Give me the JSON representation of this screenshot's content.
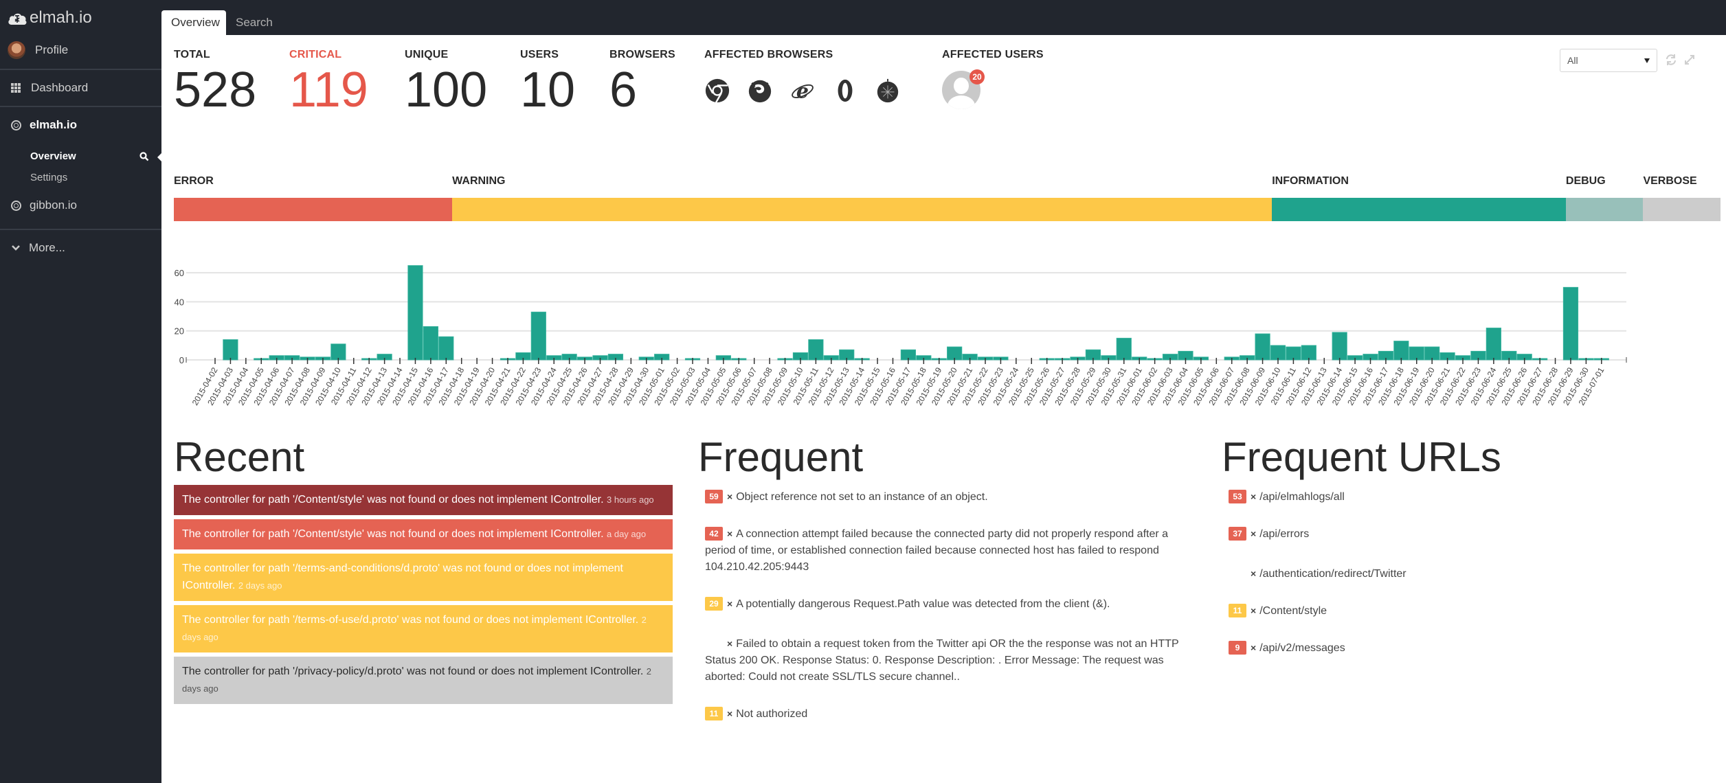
{
  "app": {
    "name": "elmah.io"
  },
  "sidebar": {
    "profile_label": "Profile",
    "dashboard_label": "Dashboard",
    "logs": [
      {
        "name": "elmah.io",
        "active": true,
        "sub": [
          {
            "label": "Overview",
            "active": true
          },
          {
            "label": "Settings",
            "active": false
          }
        ]
      },
      {
        "name": "gibbon.io",
        "active": false
      }
    ],
    "more_label": "More..."
  },
  "tabs": [
    {
      "label": "Overview",
      "active": true
    },
    {
      "label": "Search",
      "active": false
    }
  ],
  "stats": {
    "total": {
      "label": "TOTAL",
      "value": "528"
    },
    "critical": {
      "label": "CRITICAL",
      "value": "119"
    },
    "unique": {
      "label": "UNIQUE",
      "value": "100"
    },
    "users": {
      "label": "USERS",
      "value": "10"
    },
    "browsers": {
      "label": "BROWSERS",
      "value": "6"
    },
    "affected_browsers_label": "AFFECTED BROWSERS",
    "affected_browsers": [
      "chrome-icon",
      "firefox-icon",
      "internet-explorer-icon",
      "opera-icon",
      "safari-icon"
    ],
    "affected_users_label": "AFFECTED USERS",
    "affected_users_count": "20"
  },
  "filter": {
    "selected": "All"
  },
  "severity": {
    "segments": [
      {
        "label": "ERROR",
        "percent": 18,
        "color": "#e56353"
      },
      {
        "label": "WARNING",
        "percent": 53,
        "color": "#fdc848"
      },
      {
        "label": "INFORMATION",
        "percent": 19,
        "color": "#1fa38d"
      },
      {
        "label": "DEBUG",
        "percent": 5,
        "color": "#98c0ba"
      },
      {
        "label": "VERBOSE",
        "percent": 5,
        "color": "#cccccc"
      }
    ]
  },
  "chart_data": {
    "type": "bar",
    "title": "",
    "xlabel": "",
    "ylabel": "",
    "ylim": [
      0,
      65
    ],
    "yticks": [
      0,
      20,
      40,
      60
    ],
    "grid": true,
    "color": "#1fa38d",
    "categories": [
      "2015-04-02",
      "2015-04-03",
      "2015-04-04",
      "2015-04-05",
      "2015-04-06",
      "2015-04-07",
      "2015-04-08",
      "2015-04-09",
      "2015-04-10",
      "2015-04-11",
      "2015-04-12",
      "2015-04-13",
      "2015-04-14",
      "2015-04-15",
      "2015-04-16",
      "2015-04-17",
      "2015-04-18",
      "2015-04-19",
      "2015-04-20",
      "2015-04-21",
      "2015-04-22",
      "2015-04-23",
      "2015-04-24",
      "2015-04-25",
      "2015-04-26",
      "2015-04-27",
      "2015-04-28",
      "2015-04-29",
      "2015-04-30",
      "2015-05-01",
      "2015-05-02",
      "2015-05-03",
      "2015-05-04",
      "2015-05-05",
      "2015-05-06",
      "2015-05-07",
      "2015-05-08",
      "2015-05-09",
      "2015-05-10",
      "2015-05-11",
      "2015-05-12",
      "2015-05-13",
      "2015-05-14",
      "2015-05-15",
      "2015-05-16",
      "2015-05-17",
      "2015-05-18",
      "2015-05-19",
      "2015-05-20",
      "2015-05-21",
      "2015-05-22",
      "2015-05-23",
      "2015-05-24",
      "2015-05-25",
      "2015-05-26",
      "2015-05-27",
      "2015-05-28",
      "2015-05-29",
      "2015-05-30",
      "2015-05-31",
      "2015-06-01",
      "2015-06-02",
      "2015-06-03",
      "2015-06-04",
      "2015-06-05",
      "2015-06-06",
      "2015-06-07",
      "2015-06-08",
      "2015-06-09",
      "2015-06-10",
      "2015-06-11",
      "2015-06-12",
      "2015-06-13",
      "2015-06-14",
      "2015-06-15",
      "2015-06-16",
      "2015-06-17",
      "2015-06-18",
      "2015-06-19",
      "2015-06-20",
      "2015-06-21",
      "2015-06-22",
      "2015-06-23",
      "2015-06-24",
      "2015-06-25",
      "2015-06-26",
      "2015-06-27",
      "2015-06-28",
      "2015-06-29",
      "2015-06-30",
      "2015-07-01"
    ],
    "values": [
      0,
      14,
      0,
      1,
      3,
      3,
      2,
      2,
      11,
      0,
      1,
      4,
      0,
      65,
      23,
      16,
      0,
      0,
      0,
      1,
      5,
      33,
      3,
      4,
      2,
      3,
      4,
      0,
      2,
      4,
      0,
      1,
      0,
      3,
      1,
      0,
      0,
      1,
      5,
      14,
      3,
      7,
      1,
      0,
      0,
      7,
      3,
      1,
      9,
      4,
      2,
      2,
      0,
      0,
      1,
      1,
      2,
      7,
      3,
      15,
      2,
      1,
      4,
      6,
      2,
      0,
      2,
      3,
      18,
      10,
      9,
      10,
      0,
      19,
      3,
      4,
      6,
      13,
      9,
      9,
      5,
      3,
      6,
      22,
      6,
      4,
      1,
      0,
      50,
      1,
      1
    ]
  },
  "recent": {
    "title": "Recent",
    "items": [
      {
        "message": "The controller for path '/Content/style' was not found or does not implement IController.",
        "time": "3 hours ago",
        "color": "#963436",
        "dark_text": false
      },
      {
        "message": "The controller for path '/Content/style' was not found or does not implement IController.",
        "time": "a day ago",
        "color": "#e56353",
        "dark_text": false
      },
      {
        "message": "The controller for path '/terms-and-conditions/d.proto' was not found or does not implement IController.",
        "time": "2 days ago",
        "color": "#fdc848",
        "dark_text": false
      },
      {
        "message": "The controller for path '/terms-of-use/d.proto' was not found or does not implement IController.",
        "time": "2 days ago",
        "color": "#fdc848",
        "dark_text": false
      },
      {
        "message": "The controller for path '/privacy-policy/d.proto' was not found or does not implement IController.",
        "time": "2 days ago",
        "color": "#cccccc",
        "dark_text": true
      }
    ]
  },
  "frequent": {
    "title": "Frequent",
    "items": [
      {
        "count": "59",
        "color": "#e56353",
        "message": "Object reference not set to an instance of an object."
      },
      {
        "count": "42",
        "color": "#e56353",
        "message": "A connection attempt failed because the connected party did not properly respond after a period of time, or established connection failed because connected host has failed to respond 104.210.42.205:9443"
      },
      {
        "count": "29",
        "color": "#fdc848",
        "message": "A potentially dangerous Request.Path value was detected from the client (&)."
      },
      {
        "count": "",
        "color": "",
        "message": "Failed to obtain a request token from the Twitter api OR the the response was not an HTTP Status 200 OK. Response Status: 0. Response Description: . Error Message: The request was aborted: Could not create SSL/TLS secure channel.."
      },
      {
        "count": "11",
        "color": "#fdc848",
        "message": "Not authorized"
      }
    ]
  },
  "frequent_urls": {
    "title": "Frequent URLs",
    "items": [
      {
        "count": "53",
        "color": "#e56353",
        "url": "/api/elmahlogs/all"
      },
      {
        "count": "37",
        "color": "#e56353",
        "url": "/api/errors"
      },
      {
        "count": "",
        "color": "",
        "url": "/authentication/redirect/Twitter"
      },
      {
        "count": "11",
        "color": "#fdc848",
        "url": "/Content/style"
      },
      {
        "count": "9",
        "color": "#e56353",
        "url": "/api/v2/messages"
      }
    ]
  },
  "multiply_sign": "×"
}
